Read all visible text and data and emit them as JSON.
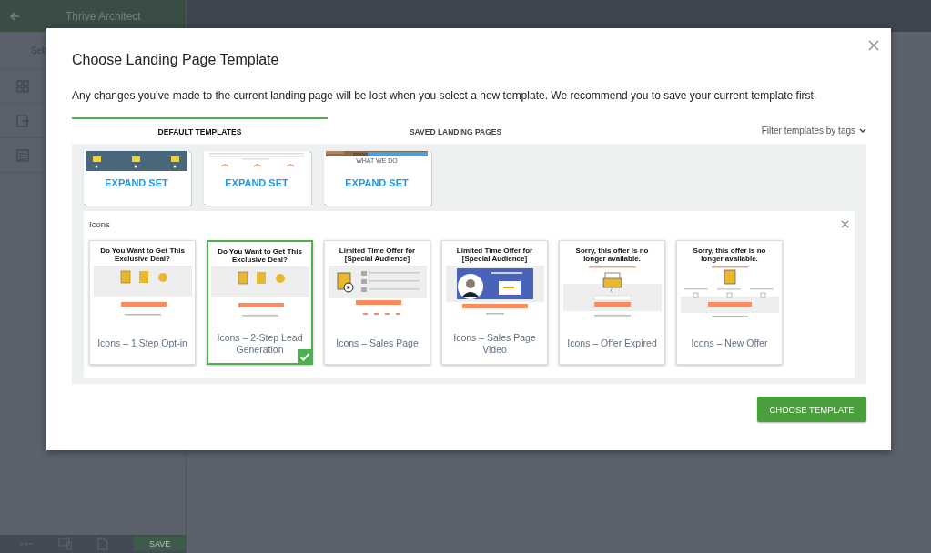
{
  "editor": {
    "title": "Thrive Architect",
    "settings_label": "Sett",
    "save_button": "SAVE"
  },
  "dialog": {
    "title": "Choose Landing Page Template",
    "notice": "Any changes you’ve made to the current landing page will be lost when you select a new template. We recommend you to save your current template first.",
    "tabs": [
      {
        "label": "DEFAULT TEMPLATES",
        "selected": true
      },
      {
        "label": "SAVED LANDING PAGES",
        "selected": false
      }
    ],
    "filter": "Filter templates by tags",
    "sets": [
      {
        "kind": "band",
        "button": "EXPAND SET"
      },
      {
        "kind": "text",
        "button": "EXPAND SET"
      },
      {
        "caption": "WHAT WE DO",
        "button": "EXPAND SET"
      }
    ],
    "group": {
      "title": "Icons",
      "templates": [
        {
          "kind": "optin",
          "preview_title": "Do You Want to Get This Exclusive Deal?",
          "label": "Icons – 1 Step Opt-in",
          "selected": false
        },
        {
          "kind": "optin",
          "preview_title": "Do You Want to Get This Exclusive Deal?",
          "label": "Icons – 2-Step Lead Generation",
          "selected": true
        },
        {
          "kind": "sales",
          "preview_title": "Limited Time Offer for [Special Audience]",
          "label": "Icons – Sales Page",
          "selected": false
        },
        {
          "kind": "video",
          "preview_title": "Limited Time Offer for [Special Audience]",
          "label": "Icons – Sales Page Video",
          "selected": false
        },
        {
          "kind": "expired",
          "preview_title": "Sorry, this offer is no longer available.",
          "label": "Icons – Offer Expired",
          "selected": false
        },
        {
          "kind": "newoffer",
          "preview_title": "Sorry, this offer is no longer available.",
          "label": "Icons – New Offer",
          "selected": false
        }
      ]
    },
    "choose_button": "CHOOSE TEMPLATE"
  }
}
